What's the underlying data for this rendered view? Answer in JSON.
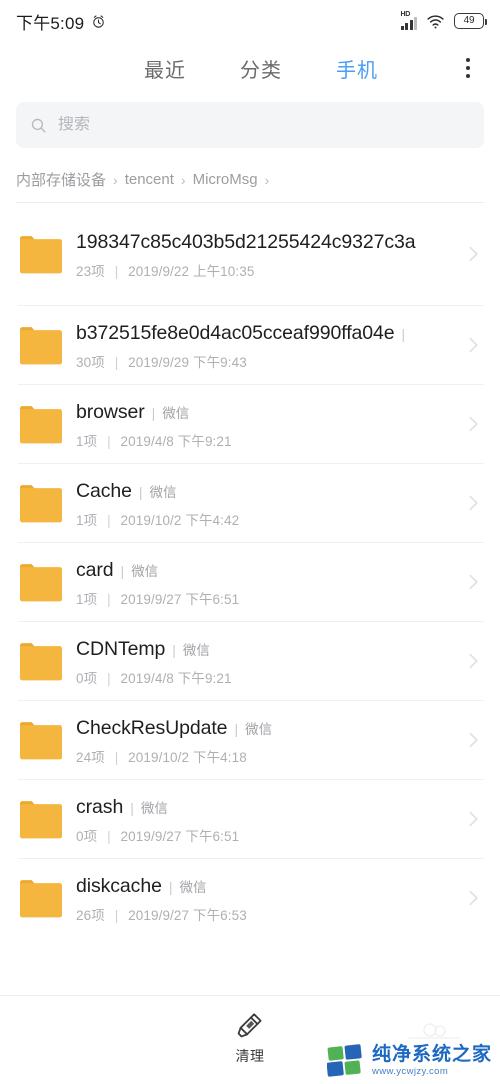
{
  "statusbar": {
    "time": "下午5:09",
    "alarm_icon": "alarm-clock-icon",
    "hd_label": "HD",
    "signal_icon": "signal-bars-icon",
    "wifi_icon": "wifi-icon",
    "battery_level": "49"
  },
  "tabs": [
    {
      "label": "最近",
      "active": false
    },
    {
      "label": "分类",
      "active": false
    },
    {
      "label": "手机",
      "active": true
    }
  ],
  "overflow_menu_icon": "more-vertical-icon",
  "search": {
    "placeholder": "搜索",
    "value": "",
    "icon": "search-icon"
  },
  "breadcrumb": {
    "items": [
      "内部存储设备",
      "tencent",
      "MicroMsg"
    ],
    "separator": "›"
  },
  "files": [
    {
      "name": "198347c85c403b5d21255424c9327c3a",
      "tag": "",
      "count": "23项",
      "date": "2019/9/22 上午10:35",
      "wrap": true
    },
    {
      "name": "b372515fe8e0d4ac05cceaf990ffa04e",
      "tag": "",
      "count": "30项",
      "date": "2019/9/29 下午9:43",
      "wrap": false
    },
    {
      "name": "browser",
      "tag": "微信",
      "count": "1项",
      "date": "2019/4/8 下午9:21",
      "wrap": false
    },
    {
      "name": "Cache",
      "tag": "微信",
      "count": "1项",
      "date": "2019/10/2 下午4:42",
      "wrap": false
    },
    {
      "name": "card",
      "tag": "微信",
      "count": "1项",
      "date": "2019/9/27 下午6:51",
      "wrap": false
    },
    {
      "name": "CDNTemp",
      "tag": "微信",
      "count": "0项",
      "date": "2019/4/8 下午9:21",
      "wrap": false
    },
    {
      "name": "CheckResUpdate",
      "tag": "微信",
      "count": "24项",
      "date": "2019/10/2 下午4:18",
      "wrap": false
    },
    {
      "name": "crash",
      "tag": "微信",
      "count": "0项",
      "date": "2019/9/27 下午6:51",
      "wrap": false
    },
    {
      "name": "diskcache",
      "tag": "微信",
      "count": "26项",
      "date": "2019/9/27 下午6:53",
      "wrap": false
    }
  ],
  "list_meta": {
    "separator": "|",
    "tag_separator": "|"
  },
  "bottombar": {
    "clean_label": "清理",
    "clean_icon": "brush-icon"
  },
  "watermark": {
    "title": "纯净系统之家",
    "url": "www.ycwjzy.com",
    "logo_icon": "four-squares-logo"
  },
  "colors": {
    "accent": "#4a9ff5",
    "folder": "#f4b63f",
    "folder_dark": "#eba92f",
    "text_primary": "#1f1f1f",
    "text_secondary": "#aeb0b4",
    "divider": "#f0f0f0",
    "search_bg": "#f4f5f7",
    "watermark_blue": "#1565c0",
    "watermark_green": "#4caf50"
  }
}
